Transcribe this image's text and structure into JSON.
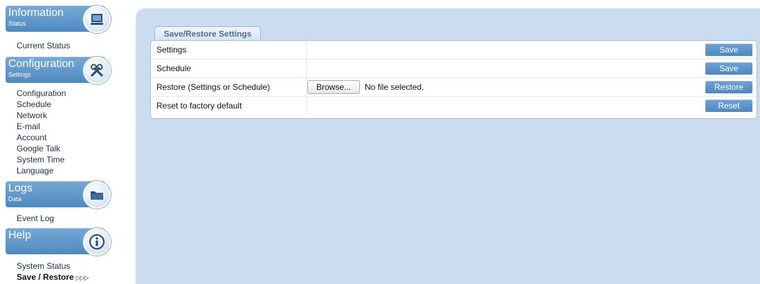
{
  "sidebar": {
    "sections": [
      {
        "title": "Information",
        "subtitle": "Status",
        "icon": "monitor-icon",
        "items": [
          "Current Status"
        ]
      },
      {
        "title": "Configuration",
        "subtitle": "Settings",
        "icon": "tools-icon",
        "items": [
          "Configuration",
          "Schedule",
          "Network",
          "E-mail",
          "Account",
          "Google Talk",
          "System Time",
          "Language"
        ]
      },
      {
        "title": "Logs",
        "subtitle": "Data",
        "icon": "folder-icon",
        "items": [
          "Event Log"
        ]
      },
      {
        "title": "Help",
        "subtitle": "",
        "icon": "info-icon",
        "items": [
          "System Status",
          "Save / Restore"
        ]
      }
    ],
    "active_item": "Save / Restore",
    "active_marker": "▷▷▷"
  },
  "main": {
    "tab_label": "Save/Restore Settings",
    "rows": [
      {
        "label": "Settings",
        "button": "Save"
      },
      {
        "label": "Schedule",
        "button": "Save"
      },
      {
        "label": "Restore (Settings or Schedule)",
        "button": "Restore",
        "browse_label": "Browse...",
        "file_status": "No file selected."
      },
      {
        "label": "Reset to factory default",
        "button": "Reset"
      }
    ]
  },
  "colors": {
    "header_blue": "#5d96cb",
    "panel_background": "#cbdcf1",
    "button_blue": "#5b93c9"
  }
}
